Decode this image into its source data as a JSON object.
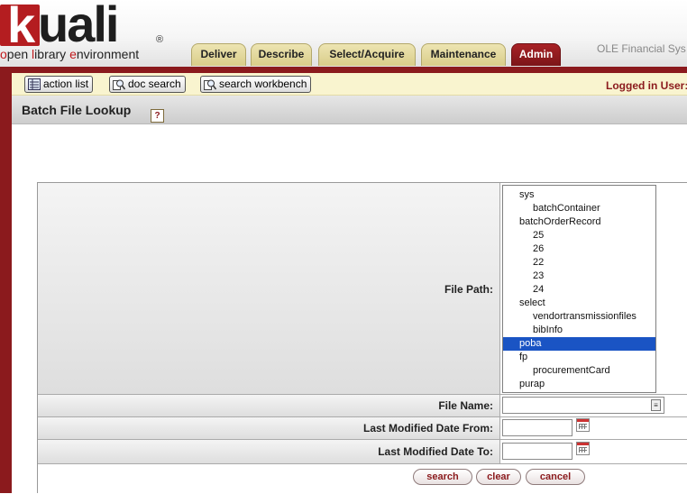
{
  "logo": {
    "k": "k",
    "rest": "uali",
    "reg": "®",
    "tagline_parts": [
      "o",
      "pen ",
      "l",
      "ibrary ",
      "e",
      "nvironment"
    ]
  },
  "tabs": [
    "Deliver",
    "Describe",
    "Select/Acquire",
    "Maintenance",
    "Admin"
  ],
  "active_tab": "Admin",
  "app_title": "OLE Financial Sys",
  "toolbar": {
    "action_list": "action list",
    "doc_search": "doc search",
    "search_workbench": "search workbench",
    "logged_in": "Logged in User:"
  },
  "page": {
    "title": "Batch File Lookup",
    "help": "?"
  },
  "form": {
    "file_path_label": "File Path:",
    "file_name_label": "File Name:",
    "date_from_label": "Last Modified Date From:",
    "date_to_label": "Last Modified Date To:",
    "file_name_value": "",
    "date_from_value": "",
    "date_to_value": ""
  },
  "file_tree": [
    {
      "label": "sys",
      "level": 0,
      "selected": false
    },
    {
      "label": "batchContainer",
      "level": 1,
      "selected": false
    },
    {
      "label": "batchOrderRecord",
      "level": 0,
      "selected": false
    },
    {
      "label": "25",
      "level": 1,
      "selected": false
    },
    {
      "label": "26",
      "level": 1,
      "selected": false
    },
    {
      "label": "22",
      "level": 1,
      "selected": false
    },
    {
      "label": "23",
      "level": 1,
      "selected": false
    },
    {
      "label": "24",
      "level": 1,
      "selected": false
    },
    {
      "label": "select",
      "level": 0,
      "selected": false
    },
    {
      "label": "vendortransmissionfiles",
      "level": 1,
      "selected": false
    },
    {
      "label": "bibInfo",
      "level": 1,
      "selected": false
    },
    {
      "label": "poba",
      "level": 0,
      "selected": true
    },
    {
      "label": "fp",
      "level": 0,
      "selected": false
    },
    {
      "label": "procurementCard",
      "level": 1,
      "selected": false
    },
    {
      "label": "purap",
      "level": 0,
      "selected": false
    }
  ],
  "buttons": {
    "search": "search",
    "clear": "clear",
    "cancel": "cancel"
  },
  "colors": {
    "brand_red": "#8b1a1d",
    "selection_blue": "#1a54c4",
    "toolbar_yellow": "#f9f4cf"
  }
}
